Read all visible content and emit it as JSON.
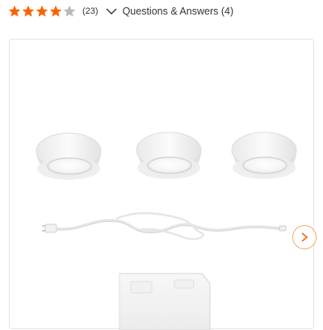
{
  "rating": {
    "stars": [
      {
        "fill": 1,
        "icon": "star-icon"
      },
      {
        "fill": 1,
        "icon": "star-icon"
      },
      {
        "fill": 1,
        "icon": "star-icon"
      },
      {
        "fill": 1,
        "icon": "star-icon"
      },
      {
        "fill": 0,
        "icon": "star-icon"
      }
    ],
    "review_count": "(23)",
    "filled_color": "#f96302",
    "empty_color": "#b8b8b8"
  },
  "qa": {
    "label": "Questions & Answers (4)",
    "icon": "chevron-down-icon"
  },
  "gallery": {
    "next_icon": "chevron-right-icon",
    "accent_color": "#f96302"
  }
}
